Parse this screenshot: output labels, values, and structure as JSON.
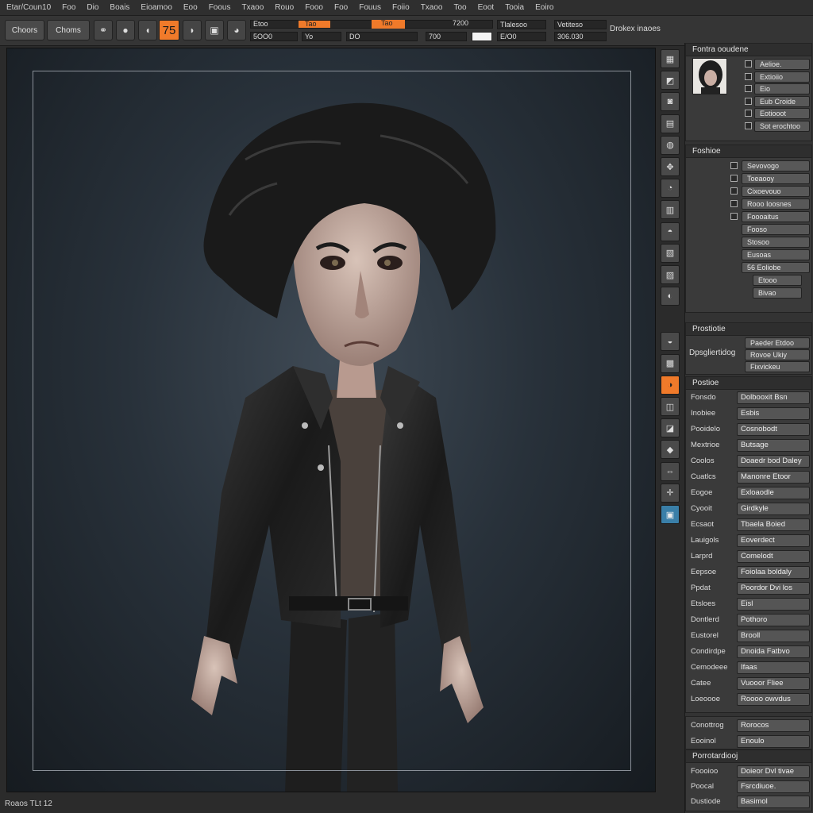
{
  "menubar": {
    "items": [
      "Etar/Coun10",
      "Foo",
      "Dio",
      "Boais",
      "Eioamoo",
      "Eoo",
      "Foous",
      "Txaoo",
      "Rouo",
      "Fooo",
      "Foo",
      "Fouus",
      "Foiio",
      "Txaoo",
      "Too",
      "Eoot",
      "Tooia",
      "Eoiro"
    ]
  },
  "toolbar": {
    "btn1": "Choors",
    "btn2": "Choms",
    "orange_value": "75",
    "slider1": {
      "label": "Etoo",
      "fill_label": "Tao",
      "right": "7200"
    },
    "slider2": {
      "label": "Etoo",
      "fill_label": "Tao"
    },
    "field_a": "5OO0",
    "field_b": "Yo",
    "field_c": "DO",
    "field_d": "700",
    "field_e": "Tlalesoo",
    "field_f": "E/O0",
    "field_g": "Vetiteso",
    "field_h": "306.030",
    "right_label": "Drokex inaoes"
  },
  "viewport": {
    "status": "Roaos TLt 12"
  },
  "toolcol": {
    "icons": [
      "mesh-icon",
      "sphere-icon",
      "camera-icon",
      "grid-icon",
      "brush-icon",
      "move-icon",
      "stroke-icon",
      "clay-icon",
      "smooth-icon",
      "mask-icon",
      "layer-icon",
      "light-icon",
      "material-icon",
      "render-icon",
      "texture-icon",
      "select-icon",
      "view-icon",
      "paint-icon",
      "symmetry-icon",
      "gizmo-icon",
      "snapshot-icon"
    ]
  },
  "panel": {
    "top_section": {
      "title": "Fontra ooudene",
      "buttons": [
        "Aelioe.",
        "Extioiio",
        "Eio",
        "Eub Croide",
        "Eotiooot",
        "Sot erochtoo"
      ]
    },
    "section2": {
      "title": "Foshioe",
      "items": [
        "Sevovogo",
        "Toeaooy",
        "Cixoevouo",
        "Rooo Ioosnes",
        "Foooaitus",
        "Fooso",
        "Stosoo",
        "Eusoas",
        "56 Eoliobe",
        "Etooo",
        "Bivao"
      ]
    },
    "section3": {
      "title": "Prostiotie",
      "label": "Dpsgliertidog",
      "items": [
        "Paeder Etdoo",
        "Rovoe Ukiy",
        "Fixvickeu"
      ]
    },
    "section4": {
      "title": "Postioe",
      "rows": [
        {
          "label": "Fonsdo",
          "value": "Dolbooxit Bsn"
        },
        {
          "label": "Inobiee",
          "value": "Esbis"
        },
        {
          "label": "Pooidelo",
          "value": "Cosnobodt"
        },
        {
          "label": "Mextrioe",
          "value": "Butsage"
        },
        {
          "label": "Coolos",
          "value": "Doaedr bod Daley"
        },
        {
          "label": "Cuatlcs",
          "value": "Manonre Etoor"
        },
        {
          "label": "Eogoe",
          "value": "Exloaodle"
        },
        {
          "label": "Cyooit",
          "value": "Girdkyle"
        },
        {
          "label": "Ecsaot",
          "value": "Tbaela Boied"
        },
        {
          "label": "Lauigols",
          "value": "Eoverdect"
        },
        {
          "label": "Larprd",
          "value": "Comelodt"
        },
        {
          "label": "Eepsoe",
          "value": "Foiolaa boldaly"
        },
        {
          "label": "Ppdat",
          "value": "Poordor Dvi los"
        },
        {
          "label": "Etsloes",
          "value": "Eisl"
        },
        {
          "label": "Dontlerd",
          "value": "Pothoro"
        },
        {
          "label": "Eustorel",
          "value": "Brooll"
        },
        {
          "label": "Condirdpe",
          "value": "Dnoida Fatbvo"
        },
        {
          "label": "Cemodeee",
          "value": "Ifaas"
        },
        {
          "label": "Catee",
          "value": "Vuooor Fliee"
        },
        {
          "label": "Loeoooe",
          "value": "Roooo owvdus"
        }
      ]
    },
    "section5": {
      "rows": [
        {
          "label": "Conottrog",
          "value": "Rorocos"
        },
        {
          "label": "Eooinol",
          "value": "Enoulo"
        }
      ]
    },
    "section6": {
      "title": "Porrotardiooj",
      "rows": [
        {
          "label": "Foooioo",
          "value": "Doieor Dvl tivae"
        },
        {
          "label": "Poocal",
          "value": "Fsrcdiuoe."
        },
        {
          "label": "Dustiode",
          "value": "Basimol"
        }
      ]
    }
  },
  "colors": {
    "accent": "#f07a2a",
    "active_blue": "#3a7fa8",
    "background": "#2b2b2b"
  }
}
